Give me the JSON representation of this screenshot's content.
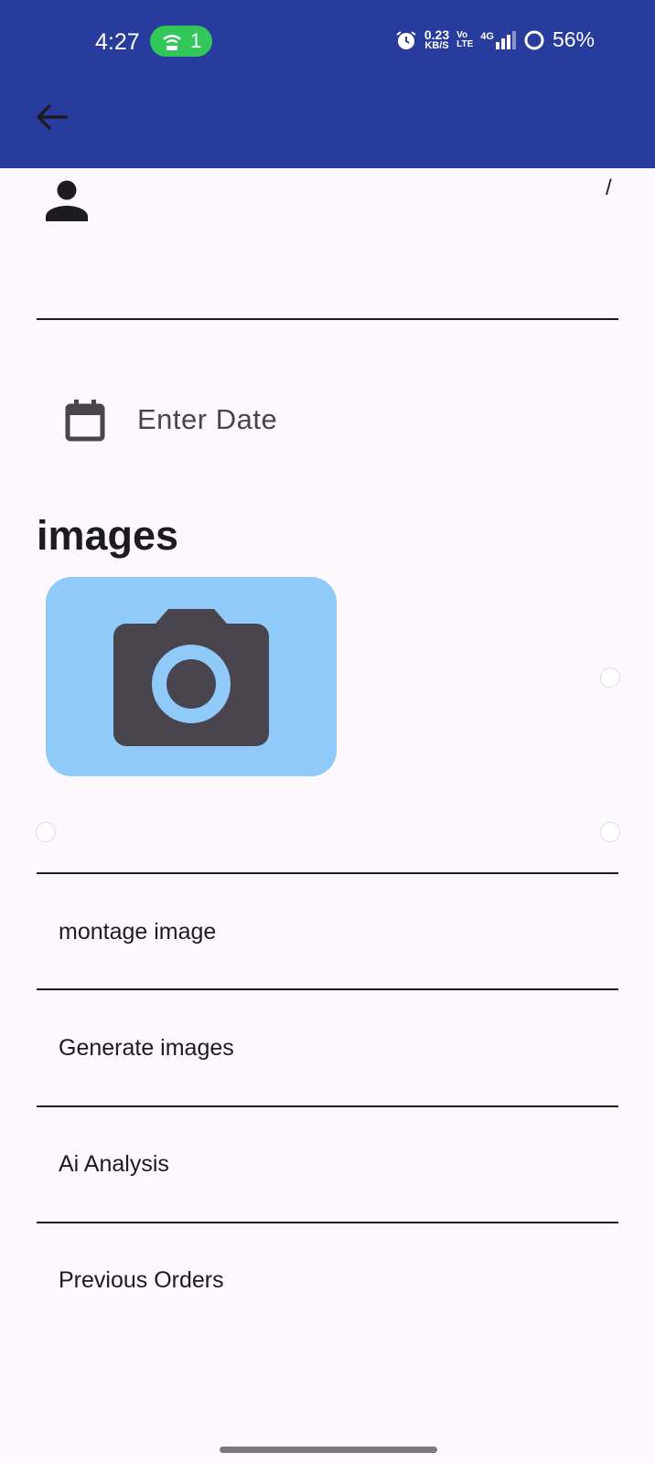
{
  "status_bar": {
    "time": "4:27",
    "hotspot_count": "1",
    "net_speed_value": "0.23",
    "net_speed_unit": "KB/S",
    "volte_top": "Vo",
    "volte_bottom": "LTE",
    "network": "4G",
    "battery": "56%"
  },
  "header": {
    "slash": "/"
  },
  "form": {
    "date_placeholder": "Enter Date"
  },
  "images_section": {
    "title": "images"
  },
  "menu": {
    "items": [
      {
        "label": "montage image"
      },
      {
        "label": "Generate images"
      },
      {
        "label": "Ai Analysis"
      },
      {
        "label": "Previous Orders"
      }
    ]
  },
  "colors": {
    "app_bar": "#283c9d",
    "camera_card": "#90caf9",
    "hotspot": "#33c659"
  }
}
